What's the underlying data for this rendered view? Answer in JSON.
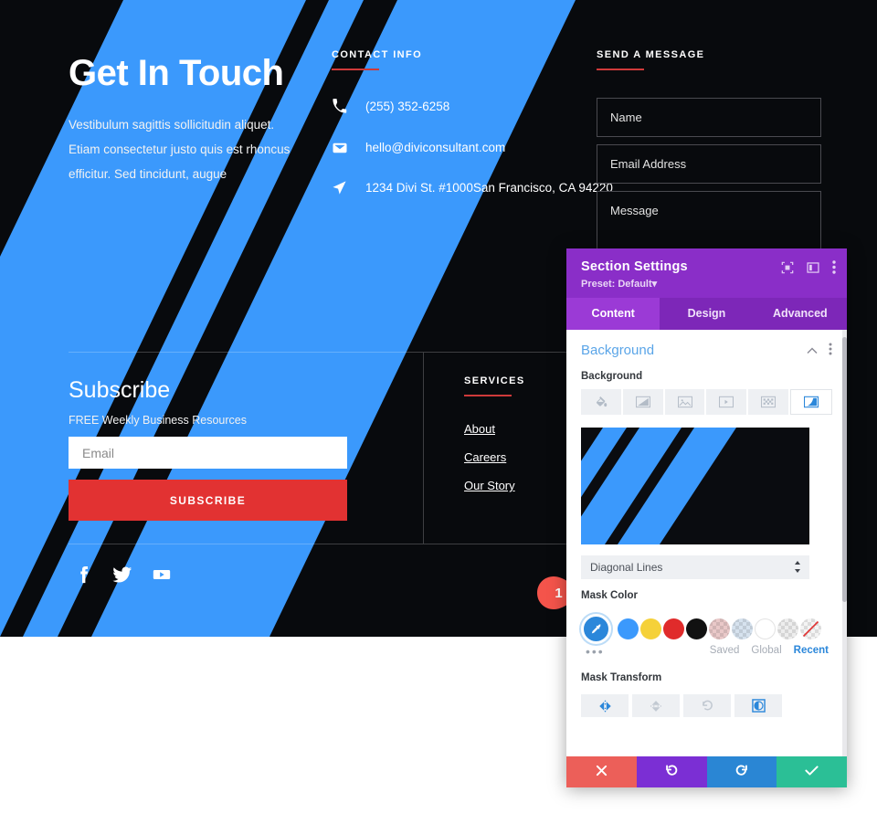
{
  "site": {
    "header": {
      "title": "Get In Touch",
      "paragraph": "Vestibulum sagittis sollicitudin aliquet. Etiam consectetur justo quis est rhoncus efficitur. Sed tincidunt, augue"
    },
    "contact": {
      "label": "CONTACT INFO",
      "items": [
        {
          "icon": "phone-icon",
          "text": "(255) 352-6258"
        },
        {
          "icon": "envelope-icon",
          "text": "hello@diviconsultant.com"
        },
        {
          "icon": "location-arrow-icon",
          "text": "1234 Divi St. #1000San Francisco, CA 94220"
        }
      ]
    },
    "message": {
      "label": "SEND A MESSAGE",
      "fields": [
        {
          "name": "name",
          "placeholder": "Name",
          "value": ""
        },
        {
          "name": "email",
          "placeholder": "Email Address",
          "value": ""
        },
        {
          "name": "message",
          "placeholder": "Message",
          "value": ""
        }
      ]
    },
    "subscribe": {
      "title": "Subscribe",
      "subtitle": "FREE Weekly Business Resources",
      "email_placeholder": "Email",
      "email_value": "",
      "button_label": "SUBSCRIBE"
    },
    "services": {
      "label": "SERVICES",
      "links": [
        "About",
        "Careers",
        "Our Story"
      ]
    },
    "socials": [
      {
        "icon": "facebook-icon",
        "name": "Facebook"
      },
      {
        "icon": "twitter-icon",
        "name": "Twitter"
      },
      {
        "icon": "youtube-icon",
        "name": "YouTube"
      }
    ],
    "colors": {
      "accent_blue": "#3b99fc",
      "dark": "#080a0d",
      "red": "#e23232",
      "rule_red": "#cf3a3a"
    }
  },
  "panel": {
    "title": "Section Settings",
    "preset": "Preset: Default",
    "preset_caret": "▾",
    "header_icons": [
      {
        "icon": "focus-target-icon"
      },
      {
        "icon": "layout-columns-icon"
      },
      {
        "icon": "kebab-menu-icon"
      }
    ],
    "tabs": [
      {
        "label": "Content",
        "active": true
      },
      {
        "label": "Design",
        "active": false
      },
      {
        "label": "Advanced",
        "active": false
      }
    ],
    "section": {
      "title": "Background",
      "collapse_icon": "chevron-up-icon",
      "menu_icon": "kebab-menu-icon"
    },
    "background": {
      "label": "Background",
      "types": [
        {
          "icon": "paint-bucket-icon",
          "name": "color",
          "active": false
        },
        {
          "icon": "gradient-icon",
          "name": "gradient",
          "active": false
        },
        {
          "icon": "image-icon",
          "name": "image",
          "active": false
        },
        {
          "icon": "video-icon",
          "name": "video",
          "active": false
        },
        {
          "icon": "pattern-icon",
          "name": "pattern",
          "active": false
        },
        {
          "icon": "mask-icon",
          "name": "mask",
          "active": true
        }
      ]
    },
    "mask_select": {
      "value": "Diagonal Lines",
      "caret_icon": "updown-caret-icon"
    },
    "mask_color": {
      "label": "Mask Color",
      "picker_icon": "eyedropper-icon",
      "swatches": [
        {
          "color": "#3b99fc",
          "transparent": false
        },
        {
          "color": "#f5d139",
          "transparent": false
        },
        {
          "color": "#e02b2b",
          "transparent": false
        },
        {
          "color": "#111111",
          "transparent": false
        },
        {
          "color": "#e3b8b8",
          "transparent": true
        },
        {
          "color": "#c9d4e0",
          "transparent": true
        },
        {
          "color": "#ffffff",
          "transparent": false
        },
        {
          "color": "#e6e6e6",
          "transparent": true
        },
        {
          "color": "#f2f2f2",
          "transparent": true,
          "strike": true
        }
      ],
      "more_icon": "ellipsis-icon",
      "tabs": [
        {
          "label": "Saved",
          "active": false
        },
        {
          "label": "Global",
          "active": false
        },
        {
          "label": "Recent",
          "active": true
        }
      ]
    },
    "mask_transform": {
      "label": "Mask Transform",
      "buttons": [
        {
          "icon": "flip-horizontal-icon",
          "active": true
        },
        {
          "icon": "flip-vertical-icon",
          "active": false
        },
        {
          "icon": "rotate-icon",
          "active": false
        },
        {
          "icon": "invert-icon",
          "active": true
        }
      ]
    },
    "footer_buttons": [
      {
        "icon": "close-x-icon",
        "name": "discard",
        "color": "#ec5f59"
      },
      {
        "icon": "undo-icon",
        "name": "undo",
        "color": "#7b2fd4"
      },
      {
        "icon": "redo-icon",
        "name": "redo",
        "color": "#2a86d4"
      },
      {
        "icon": "check-icon",
        "name": "save",
        "color": "#2bbf96"
      }
    ]
  },
  "callout": {
    "number": "1"
  }
}
